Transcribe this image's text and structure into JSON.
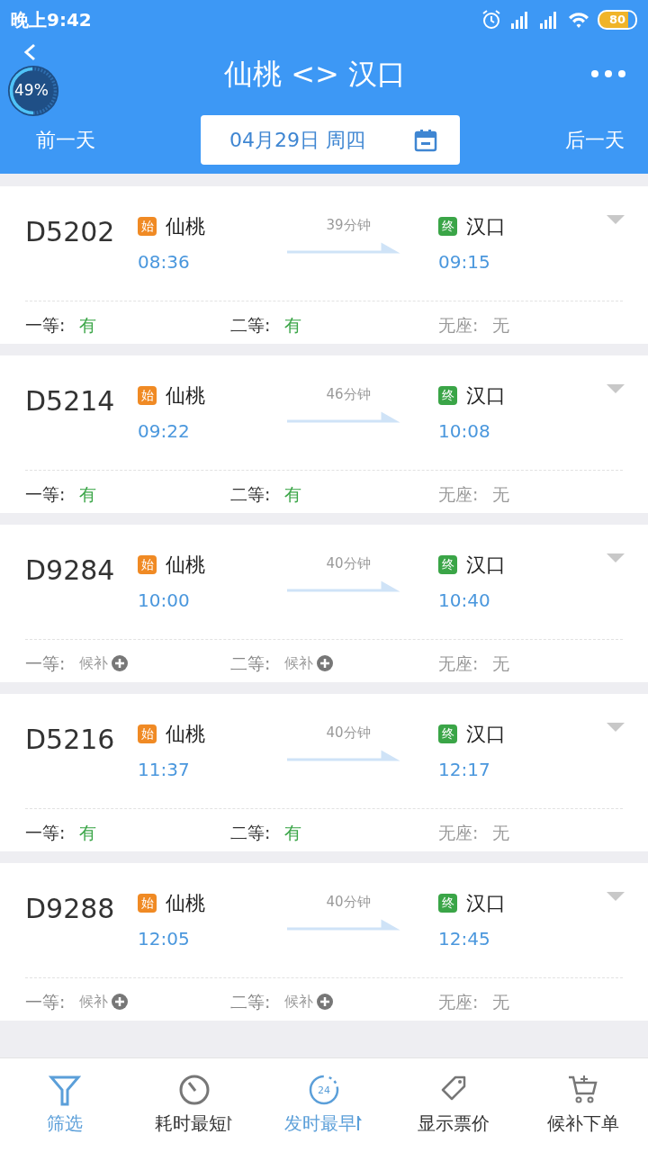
{
  "status_bar": {
    "time": "晚上9:42",
    "battery": "80"
  },
  "header": {
    "title": "仙桃 <> 汉口",
    "prev_day": "前一天",
    "date": "04月29日 周四",
    "next_day": "后一天"
  },
  "float_widget": {
    "percent": "49%",
    "level": 0.49
  },
  "trains": [
    {
      "number": "D5202",
      "from_badge": "始",
      "from": "仙桃",
      "depart": "08:36",
      "duration": "39分钟",
      "to_badge": "终",
      "to": "汉口",
      "arrive": "09:15",
      "seats": [
        {
          "label": "一等:",
          "status": "有",
          "kind": "available"
        },
        {
          "label": "二等:",
          "status": "有",
          "kind": "available"
        },
        {
          "label": "无座:",
          "status": "无",
          "kind": "none"
        }
      ]
    },
    {
      "number": "D5214",
      "from_badge": "始",
      "from": "仙桃",
      "depart": "09:22",
      "duration": "46分钟",
      "to_badge": "终",
      "to": "汉口",
      "arrive": "10:08",
      "seats": [
        {
          "label": "一等:",
          "status": "有",
          "kind": "available"
        },
        {
          "label": "二等:",
          "status": "有",
          "kind": "available"
        },
        {
          "label": "无座:",
          "status": "无",
          "kind": "none"
        }
      ]
    },
    {
      "number": "D9284",
      "from_badge": "始",
      "from": "仙桃",
      "depart": "10:00",
      "duration": "40分钟",
      "to_badge": "终",
      "to": "汉口",
      "arrive": "10:40",
      "seats": [
        {
          "label": "一等:",
          "status": "候补",
          "kind": "waitlist"
        },
        {
          "label": "二等:",
          "status": "候补",
          "kind": "waitlist"
        },
        {
          "label": "无座:",
          "status": "无",
          "kind": "none"
        }
      ]
    },
    {
      "number": "D5216",
      "from_badge": "始",
      "from": "仙桃",
      "depart": "11:37",
      "duration": "40分钟",
      "to_badge": "终",
      "to": "汉口",
      "arrive": "12:17",
      "seats": [
        {
          "label": "一等:",
          "status": "有",
          "kind": "available"
        },
        {
          "label": "二等:",
          "status": "有",
          "kind": "available"
        },
        {
          "label": "无座:",
          "status": "无",
          "kind": "none"
        }
      ]
    },
    {
      "number": "D9288",
      "from_badge": "始",
      "from": "仙桃",
      "depart": "12:05",
      "duration": "40分钟",
      "to_badge": "终",
      "to": "汉口",
      "arrive": "12:45",
      "seats": [
        {
          "label": "一等:",
          "status": "候补",
          "kind": "waitlist"
        },
        {
          "label": "二等:",
          "status": "候补",
          "kind": "waitlist"
        },
        {
          "label": "无座:",
          "status": "无",
          "kind": "none"
        }
      ]
    }
  ],
  "bottom_tabs": [
    {
      "label": "筛选",
      "kind": "filter",
      "selected": true
    },
    {
      "label": "耗时最短",
      "kind": "timer",
      "selected": false,
      "sort": true
    },
    {
      "label": "发时最早",
      "kind": "clock24",
      "icon_text": "24",
      "selected": true,
      "sort": true
    },
    {
      "label": "显示票价",
      "kind": "tag",
      "selected": false
    },
    {
      "label": "候补下单",
      "kind": "cart",
      "selected": false
    }
  ]
}
